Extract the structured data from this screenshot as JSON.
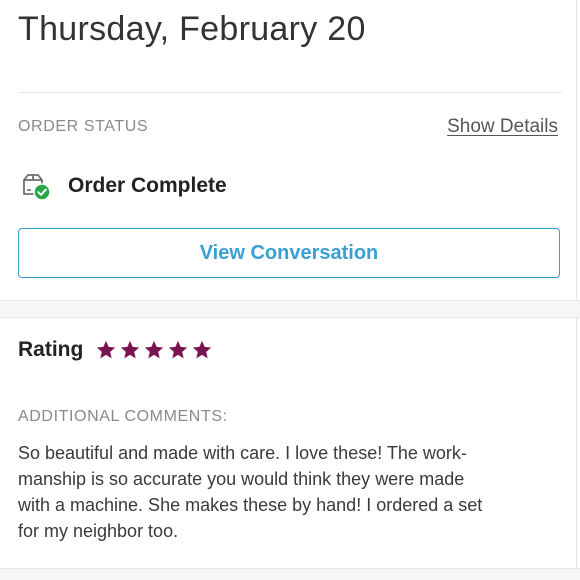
{
  "header": {
    "date": "Thursday, February 20"
  },
  "order_status": {
    "label": "ORDER STATUS",
    "show_details": "Show Details",
    "status_icon": "package-check-icon",
    "status_text": "Order Complete",
    "status_color": "#27a745"
  },
  "conversation_button": {
    "label": "View Conversation",
    "color": "#3a9fd3"
  },
  "rating": {
    "label": "Rating",
    "stars": 5,
    "max_stars": 5,
    "star_color": "#7a1351"
  },
  "comments": {
    "label": "ADDITIONAL COMMENTS:",
    "lines": [
      "So beautiful and made with care. I love these! The work-",
      "manship is so accurate you would think they were made",
      "with a machine. She makes these by hand! I ordered a set",
      "for my neighbor too."
    ]
  }
}
